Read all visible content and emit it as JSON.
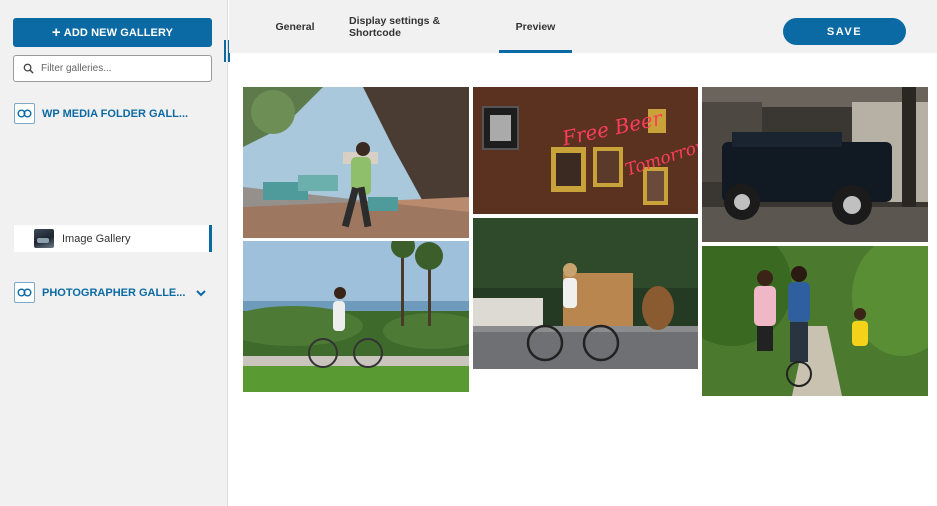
{
  "sidebar": {
    "add_button_label": "ADD NEW GALLERY",
    "filter_placeholder": "Filter galleries...",
    "galleries": [
      {
        "label": "WP MEDIA FOLDER GALL...",
        "icon": "gallery-icon"
      },
      {
        "label": "PHOTOGRAPHER GALLE...",
        "icon": "gallery-icon",
        "expand_icon": "chevron-down-icon"
      }
    ],
    "selected_subgallery": {
      "label": "Image Gallery"
    }
  },
  "tabs": [
    {
      "label": "General",
      "active": false
    },
    {
      "label": "Display settings & Shortcode",
      "active": false
    },
    {
      "label": "Preview",
      "active": true
    }
  ],
  "save_label": "SAVE",
  "colors": {
    "accent": "#0b6aa3",
    "sidebar_bg": "#f1f1f1"
  },
  "preview": {
    "images": [
      {
        "name": "man-carrying-boxes"
      },
      {
        "name": "free-beer-tomorrow-neon"
      },
      {
        "name": "vintage-suv-garage"
      },
      {
        "name": "woman-cycling-coast"
      },
      {
        "name": "woman-cycling-street"
      },
      {
        "name": "family-bike-path"
      }
    ],
    "neon_text": [
      "Free Beer",
      "Tomorrow"
    ]
  }
}
